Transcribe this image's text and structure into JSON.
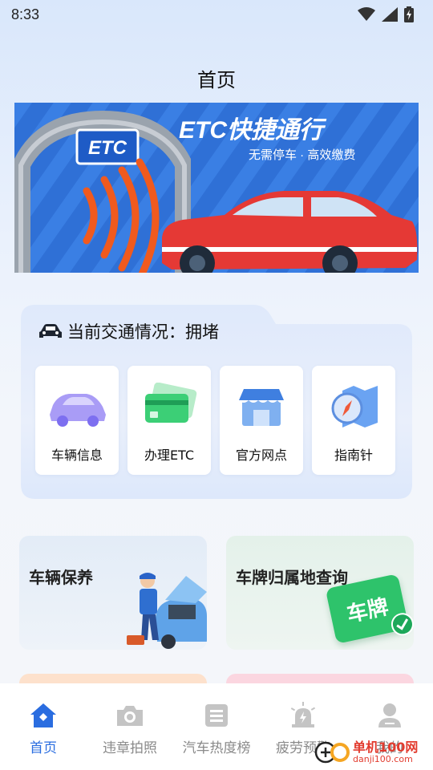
{
  "status_bar": {
    "time": "8:33",
    "icons": [
      "wifi-icon",
      "cellular-signal-icon",
      "battery-charging-icon"
    ]
  },
  "header": {
    "title": "首页"
  },
  "banner": {
    "title": "ETC快捷通行",
    "subtitle": "无需停车 · 高效缴费",
    "sign": "ETC"
  },
  "traffic": {
    "prefix": "当前交通情况：",
    "status": "拥堵",
    "icon": "car-icon"
  },
  "services": [
    {
      "label": "车辆信息",
      "icon": "car-info-icon"
    },
    {
      "label": "办理ETC",
      "icon": "etc-card-icon"
    },
    {
      "label": "官方网点",
      "icon": "store-icon"
    },
    {
      "label": "指南针",
      "icon": "compass-map-icon"
    }
  ],
  "features": [
    {
      "title": "车辆保养",
      "icon": "mechanic-illustration"
    },
    {
      "title": "车牌归属地查询",
      "icon": "license-plate-badge",
      "badge": "车牌"
    }
  ],
  "tabs": [
    {
      "label": "首页",
      "icon": "home-icon",
      "active": true
    },
    {
      "label": "违章拍照",
      "icon": "camera-icon",
      "active": false
    },
    {
      "label": "汽车热度榜",
      "icon": "list-icon",
      "active": false
    },
    {
      "label": "疲劳预警",
      "icon": "alarm-light-icon",
      "active": false
    },
    {
      "label": "我的",
      "icon": "profile-icon",
      "active": false
    }
  ],
  "watermark": {
    "main": "单机100网",
    "sub": "danji100.com"
  },
  "colors": {
    "accent": "#2a6de0",
    "inactive": "#8a8a8a",
    "banner_bg": "#2f70d6",
    "car_red": "#e53935"
  }
}
